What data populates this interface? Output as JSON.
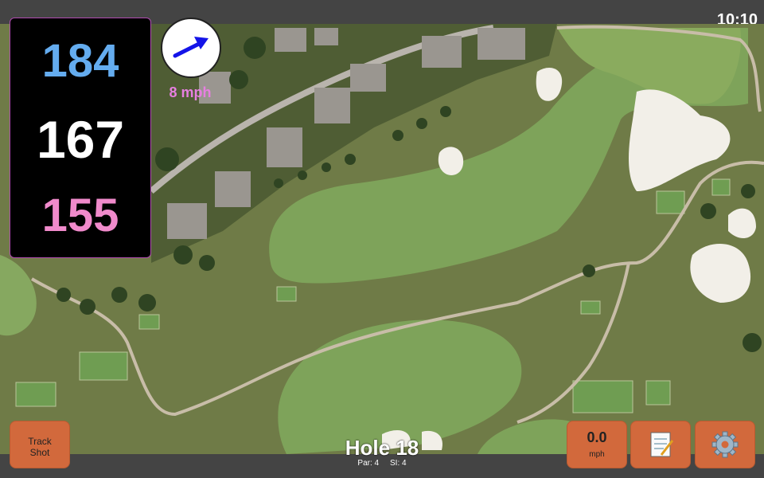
{
  "status_bar": {
    "time": "10:10"
  },
  "yardages": {
    "back": "184",
    "center": "167",
    "front": "155"
  },
  "wind": {
    "speed": "8 mph",
    "icon": "wind-arrow-icon"
  },
  "buttons": {
    "track_shot": [
      "Track",
      "Shot"
    ],
    "wind_speed_value": "0.0",
    "wind_speed_unit": "mph",
    "notes_icon": "notepad-icon",
    "settings_icon": "gear-icon"
  },
  "hole": {
    "title": "Hole 18",
    "par": "Par: 4",
    "si": "SI: 4"
  },
  "colors": {
    "back": "#64acef",
    "center": "#ffffff",
    "front": "#f08acb",
    "button": "#d2693c",
    "wind_text": "#e67fe0"
  }
}
